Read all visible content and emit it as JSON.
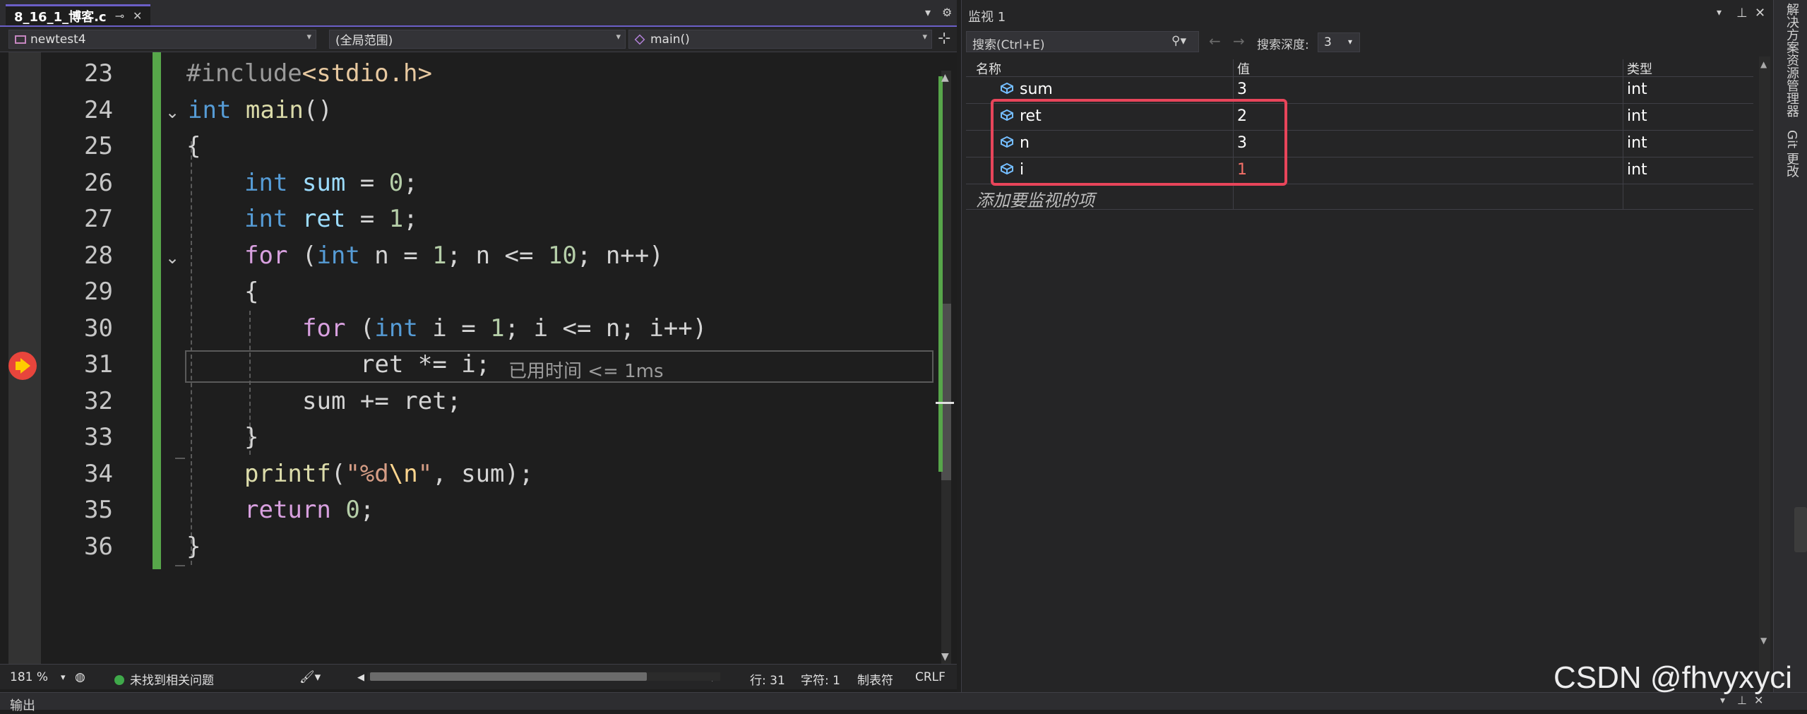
{
  "editor": {
    "tab": {
      "title": "8_16_1_博客.c",
      "pin": "⊸",
      "close": "✕"
    },
    "nav": {
      "project": "newtest4",
      "scope": "(全局范围)",
      "function": "main()"
    },
    "line_numbers": [
      "23",
      "24",
      "25",
      "26",
      "27",
      "28",
      "29",
      "30",
      "31",
      "32",
      "33",
      "34",
      "35",
      "36"
    ],
    "code": {
      "l23_inc": "#include",
      "l23_file": "<stdio.h>",
      "l24_kw": "int",
      "l24_fn": "main",
      "l24_rest": "()",
      "l25": "{",
      "l26_kw": "int",
      "l26_var": "sum",
      "l26_op": " = ",
      "l26_num": "0",
      "l26_end": ";",
      "l27_kw": "int",
      "l27_var": "ret",
      "l27_op": " = ",
      "l27_num": "1",
      "l27_end": ";",
      "l28_for": "for",
      "l28_a": " (",
      "l28_kw": "int",
      "l28_b": " n = ",
      "l28_n1": "1",
      "l28_c": "; n <= ",
      "l28_n10": "10",
      "l28_d": "; n++)",
      "l29": "{",
      "l30_for": "for",
      "l30_a": " (",
      "l30_kw": "int",
      "l30_b": " i = ",
      "l30_n1": "1",
      "l30_c": "; i <= n; i++)",
      "l31": "ret *= i;",
      "l31_hint": "已用时间 <= 1ms",
      "l32": "sum += ret;",
      "l33": "}",
      "l34_fn": "printf",
      "l34_a": "(",
      "l34_str1": "\"%d",
      "l34_esc": "\\n",
      "l34_str2": "\"",
      "l34_b": ", sum);",
      "l35_kw": "return",
      "l35_a": " ",
      "l35_num": "0",
      "l35_b": ";",
      "l36": "}"
    },
    "status": {
      "zoom": "181 %",
      "issues": "未找到相关问题",
      "line": "行: 31",
      "col": "字符: 1",
      "tabs": "制表符",
      "eol": "CRLF"
    }
  },
  "watch": {
    "title": "监视 1",
    "search_placeholder": "搜索(Ctrl+E)",
    "depth_label": "搜索深度:",
    "depth_value": "3",
    "columns": {
      "name": "名称",
      "value": "值",
      "type": "类型"
    },
    "rows": [
      {
        "name": "sum",
        "value": "3",
        "type": "int",
        "changed": false
      },
      {
        "name": "ret",
        "value": "2",
        "type": "int",
        "changed": false
      },
      {
        "name": "n",
        "value": "3",
        "type": "int",
        "changed": false
      },
      {
        "name": "i",
        "value": "1",
        "type": "int",
        "changed": true
      }
    ],
    "add_item": "添加要监视的项"
  },
  "sidebar": {
    "solution_explorer": "解决方案资源管理器",
    "git_changes": "Git 更改"
  },
  "output": {
    "title": "输出"
  },
  "watermark": "CSDN @fhvyxyci",
  "colors": {
    "accent": "#6b5fc7",
    "highlight": "#e8455a",
    "changed_value": "#f47068",
    "change_bar": "#57a64a"
  }
}
